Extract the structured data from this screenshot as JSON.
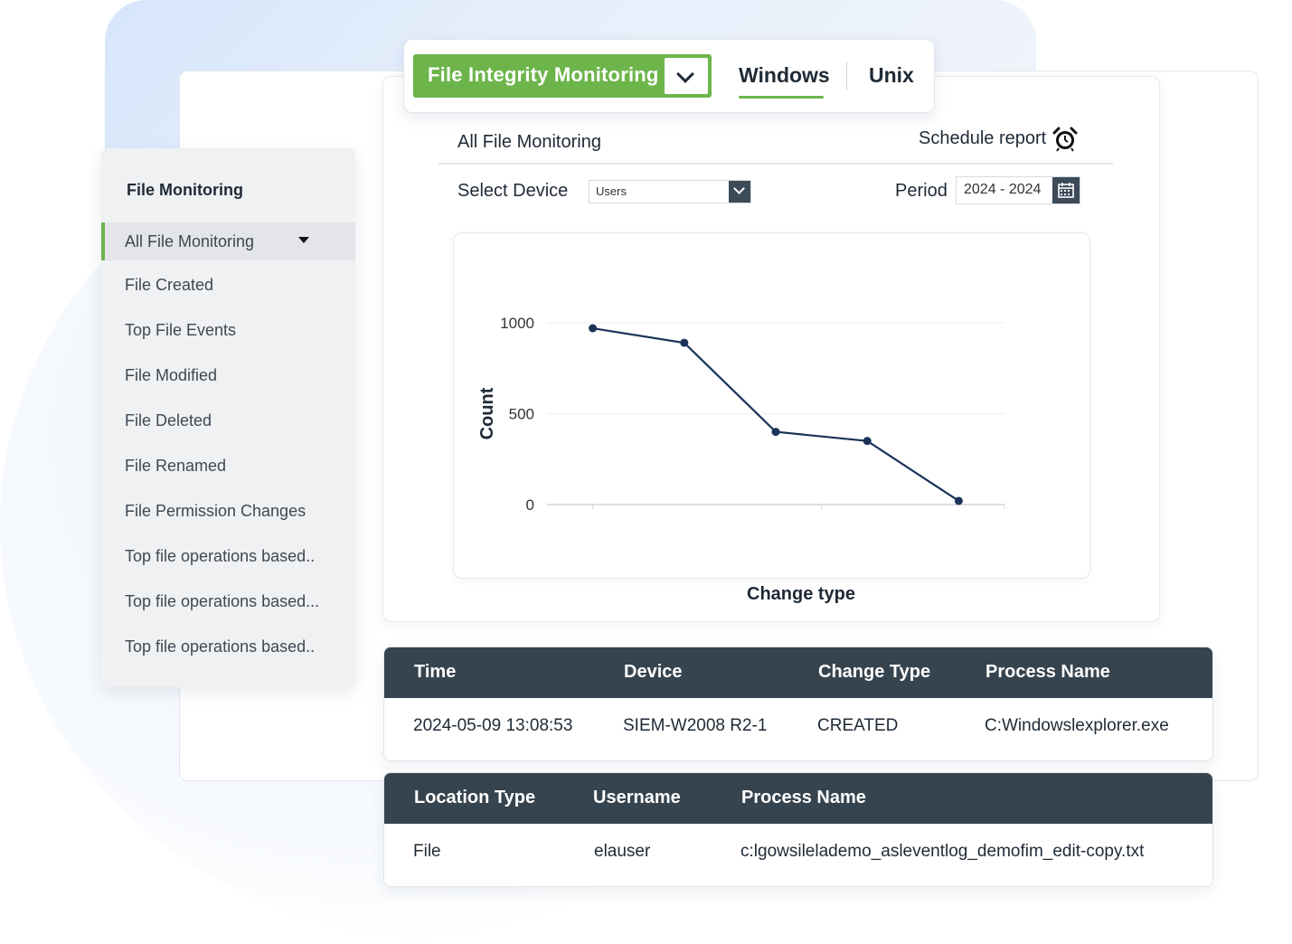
{
  "header": {
    "module_label": "File Integrity  Monitoring",
    "tabs": [
      "Windows",
      "Unix"
    ],
    "active_tab": "Windows",
    "accent_color": "#6db54b",
    "dark_color": "#36444f"
  },
  "sidebar": {
    "title": "File Monitoring",
    "items": [
      {
        "label": "All File Monitoring",
        "active": true
      },
      {
        "label": "File Created"
      },
      {
        "label": "Top File Events"
      },
      {
        "label": "File Modified"
      },
      {
        "label": "File Deleted"
      },
      {
        "label": "File Renamed"
      },
      {
        "label": "File Permission Changes"
      },
      {
        "label": "Top file operations based.."
      },
      {
        "label": "Top file operations based..."
      },
      {
        "label": "Top file operations based.."
      }
    ]
  },
  "report": {
    "title": "All File Monitoring",
    "schedule_label": "Schedule report",
    "schedule_icon": "alarm-clock-icon",
    "device_label": "Select Device",
    "device_value": "Users",
    "period_label": "Period",
    "period_value": "2024 - 2024",
    "calendar_icon": "calendar-icon"
  },
  "chart_data": {
    "type": "line",
    "x": [
      1,
      2,
      3,
      4,
      5
    ],
    "values": [
      970,
      890,
      400,
      350,
      20
    ],
    "ylabel": "Count",
    "xlabel": "Change type",
    "yticks": [
      0,
      500,
      1000
    ],
    "ylim": [
      0,
      1000
    ],
    "grid": true,
    "line_color": "#1a3358"
  },
  "table1": {
    "headers": [
      "Time",
      "Device",
      "Change Type",
      "Process Name"
    ],
    "rows": [
      [
        "2024-05-09 13:08:53",
        "SIEM-W2008 R2-1",
        "CREATED",
        "C:Windowslexplorer.exe"
      ]
    ]
  },
  "table2": {
    "headers": [
      "Location Type",
      "Username",
      "Process Name"
    ],
    "rows": [
      [
        "File",
        "elauser",
        "c:lgowsilelademo_asleventlog_demofim_edit-copy.txt"
      ]
    ]
  }
}
